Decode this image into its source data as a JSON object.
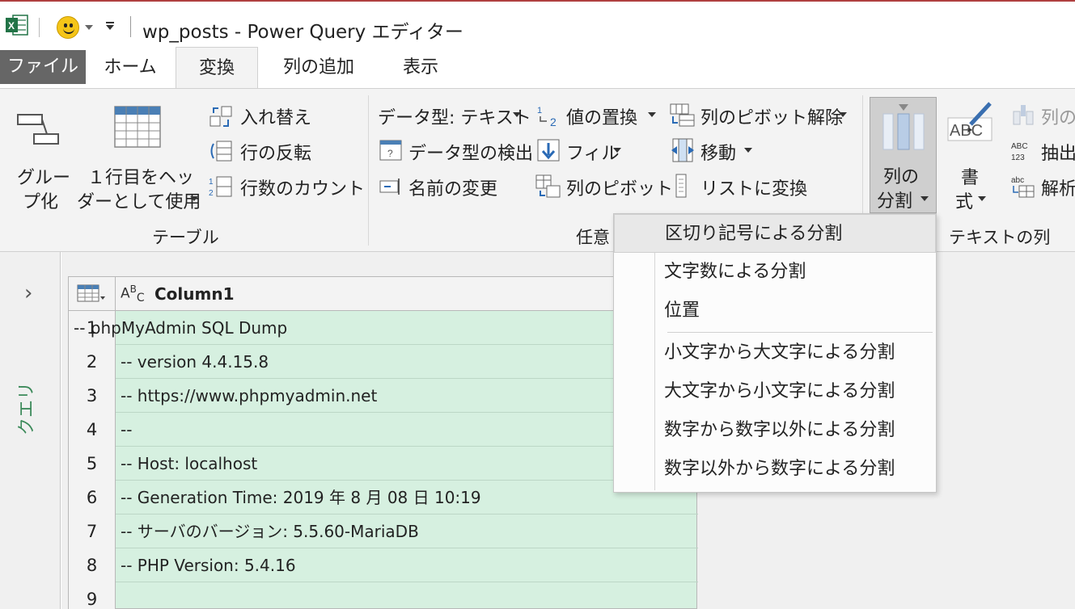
{
  "window": {
    "title": "wp_posts - Power Query エディター"
  },
  "tabs": [
    {
      "label": "ファイル"
    },
    {
      "label": "ホーム"
    },
    {
      "label": "変換"
    },
    {
      "label": "列の追加"
    },
    {
      "label": "表示"
    }
  ],
  "ribbon": {
    "table_group": {
      "group_by_line1": "グルー",
      "group_by_line2": "プ化",
      "use_header_line1": "１行目をヘッ",
      "use_header_line2": "ダーとして使用",
      "transpose": "入れ替え",
      "reverse_rows": "行の反転",
      "count_rows": "行数のカウント",
      "label": "テーブル"
    },
    "any_column_group": {
      "data_type": "データ型: テキスト",
      "detect_type": "データ型の検出",
      "rename": "名前の変更",
      "replace_values": "値の置換",
      "fill": "フィル",
      "pivot": "列のピボット",
      "unpivot": "列のピボット解除",
      "move": "移動",
      "to_list": "リストに変換",
      "label": "任意"
    },
    "text_column_group": {
      "split_line1": "列の",
      "split_line2": "分割",
      "format_line1": "書",
      "format_line2": "式",
      "merge_partial": "列の",
      "extract_partial": "抽出",
      "parse_partial": "解析",
      "label": "テキストの列"
    }
  },
  "query_panel": {
    "label": "クエリ"
  },
  "grid": {
    "column_header": "Column1",
    "type_icon": "ABC",
    "rows": [
      {
        "n": "1",
        "v": "-- phpMyAdmin SQL Dump"
      },
      {
        "n": "2",
        "v": "-- version 4.4.15.8"
      },
      {
        "n": "3",
        "v": "-- https://www.phpmyadmin.net"
      },
      {
        "n": "4",
        "v": "--"
      },
      {
        "n": "5",
        "v": "-- Host: localhost"
      },
      {
        "n": "6",
        "v": "-- Generation Time: 2019 年 8 月 08 日 10:19"
      },
      {
        "n": "7",
        "v": "-- サーバのバージョン: 5.5.60-MariaDB"
      },
      {
        "n": "8",
        "v": "-- PHP Version: 5.4.16"
      },
      {
        "n": "9",
        "v": ""
      }
    ]
  },
  "split_menu": {
    "items": [
      "区切り記号による分割",
      "文字数による分割",
      "位置",
      "小文字から大文字による分割",
      "大文字から小文字による分割",
      "数字から数字以外による分割",
      "数字以外から数字による分割"
    ]
  },
  "colors": {
    "file_tab_bg": "#666666",
    "grid_bg": "#d6f0e0",
    "query_label": "#3c8a5a",
    "excel_green": "#217346"
  }
}
